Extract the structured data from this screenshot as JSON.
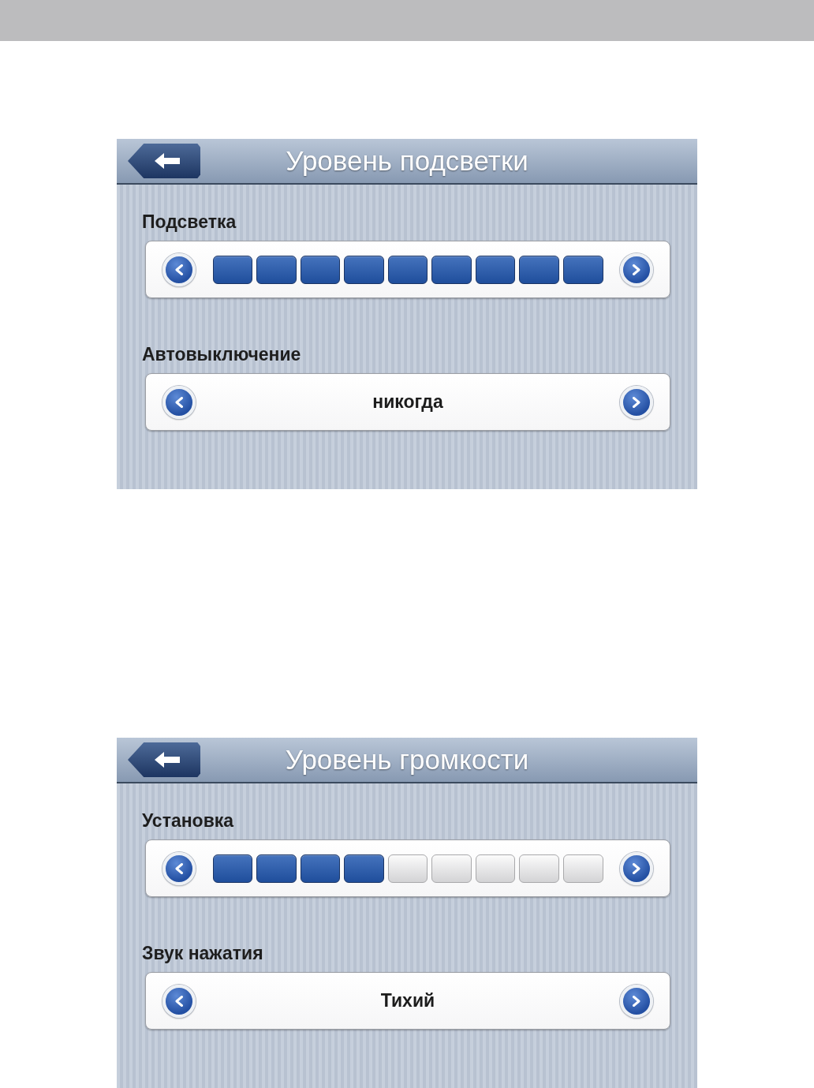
{
  "screens": [
    {
      "title": "Уровень подсветки",
      "settings": [
        {
          "kind": "segments",
          "label": "Подсветка",
          "segments": [
            {
              "on": true
            },
            {
              "on": true
            },
            {
              "on": true
            },
            {
              "on": true
            },
            {
              "on": true
            },
            {
              "on": true
            },
            {
              "on": true
            },
            {
              "on": true
            },
            {
              "on": true
            }
          ]
        },
        {
          "kind": "choice",
          "label": "Автовыключение",
          "value": "никогда"
        }
      ]
    },
    {
      "title": "Уровень громкости",
      "settings": [
        {
          "kind": "segments",
          "label": "Установка",
          "segments": [
            {
              "on": true
            },
            {
              "on": true
            },
            {
              "on": true
            },
            {
              "on": true
            },
            {
              "on": false
            },
            {
              "on": false
            },
            {
              "on": false
            },
            {
              "on": false
            },
            {
              "on": false
            }
          ]
        },
        {
          "kind": "choice",
          "label": "Звук нажатия",
          "value": "Тихий"
        }
      ]
    }
  ]
}
